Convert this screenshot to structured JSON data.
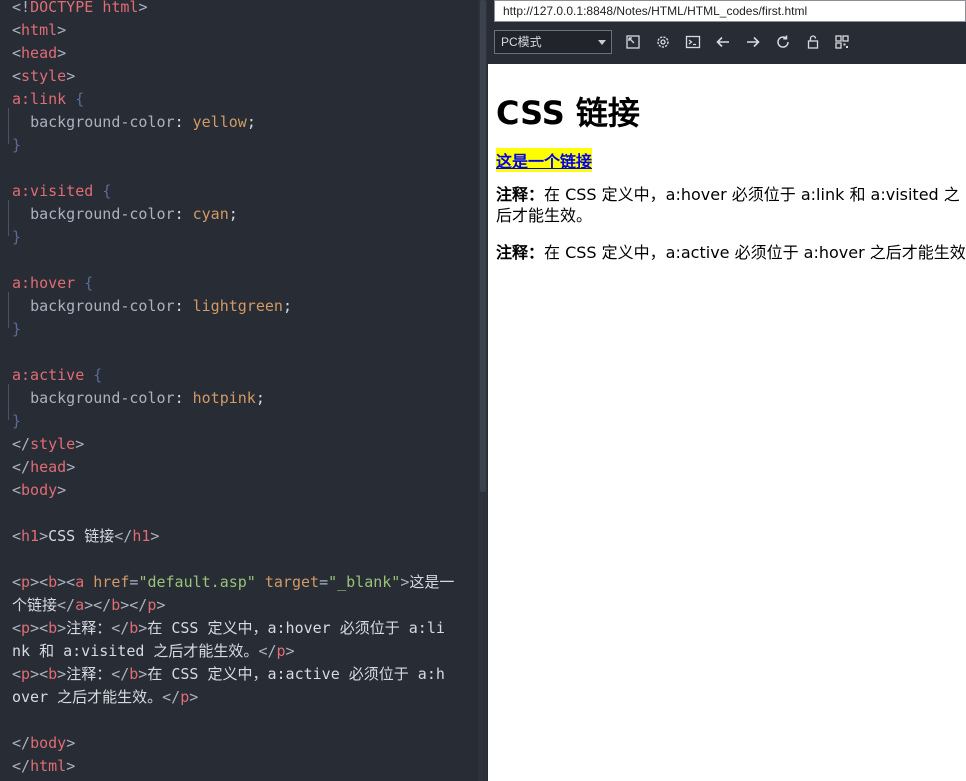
{
  "editor": {
    "lines": [
      [
        [
          "punc",
          "<!"
        ],
        [
          "doctype",
          "DOCTYPE "
        ],
        [
          "tag",
          "html"
        ],
        [
          "punc",
          ">"
        ]
      ],
      [
        [
          "punc",
          "<"
        ],
        [
          "tag",
          "html"
        ],
        [
          "punc",
          ">"
        ]
      ],
      [
        [
          "punc",
          "<"
        ],
        [
          "tag",
          "head"
        ],
        [
          "punc",
          ">"
        ]
      ],
      [
        [
          "punc",
          "<"
        ],
        [
          "tag",
          "style"
        ],
        [
          "punc",
          ">"
        ]
      ],
      [
        [
          "sel",
          "a:link"
        ],
        [
          "txt",
          " "
        ],
        [
          "brace",
          "{"
        ]
      ],
      [
        [
          "txt",
          "  "
        ],
        [
          "prop",
          "background-color"
        ],
        [
          "txt",
          ": "
        ],
        [
          "val",
          "yellow"
        ],
        [
          "txt",
          ";"
        ]
      ],
      [
        [
          "brace",
          "}"
        ]
      ],
      [
        [
          "txt",
          ""
        ]
      ],
      [
        [
          "sel",
          "a:visited"
        ],
        [
          "txt",
          " "
        ],
        [
          "brace",
          "{"
        ]
      ],
      [
        [
          "txt",
          "  "
        ],
        [
          "prop",
          "background-color"
        ],
        [
          "txt",
          ": "
        ],
        [
          "val",
          "cyan"
        ],
        [
          "txt",
          ";"
        ]
      ],
      [
        [
          "brace",
          "}"
        ]
      ],
      [
        [
          "txt",
          ""
        ]
      ],
      [
        [
          "sel",
          "a:hover"
        ],
        [
          "txt",
          " "
        ],
        [
          "brace",
          "{"
        ]
      ],
      [
        [
          "txt",
          "  "
        ],
        [
          "prop",
          "background-color"
        ],
        [
          "txt",
          ": "
        ],
        [
          "val",
          "lightgreen"
        ],
        [
          "txt",
          ";"
        ]
      ],
      [
        [
          "brace",
          "}"
        ]
      ],
      [
        [
          "txt",
          ""
        ]
      ],
      [
        [
          "sel",
          "a:active"
        ],
        [
          "txt",
          " "
        ],
        [
          "brace",
          "{"
        ]
      ],
      [
        [
          "txt",
          "  "
        ],
        [
          "prop",
          "background-color"
        ],
        [
          "txt",
          ": "
        ],
        [
          "val",
          "hotpink"
        ],
        [
          "txt",
          ";"
        ]
      ],
      [
        [
          "brace",
          "}"
        ]
      ],
      [
        [
          "punc",
          "</"
        ],
        [
          "tag",
          "style"
        ],
        [
          "punc",
          ">"
        ]
      ],
      [
        [
          "punc",
          "</"
        ],
        [
          "tag",
          "head"
        ],
        [
          "punc",
          ">"
        ]
      ],
      [
        [
          "punc",
          "<"
        ],
        [
          "tag",
          "body"
        ],
        [
          "punc",
          ">"
        ]
      ],
      [
        [
          "txt",
          ""
        ]
      ],
      [
        [
          "punc",
          "<"
        ],
        [
          "tag",
          "h1"
        ],
        [
          "punc",
          ">"
        ],
        [
          "txt",
          "CSS 链接"
        ],
        [
          "punc",
          "</"
        ],
        [
          "tag",
          "h1"
        ],
        [
          "punc",
          ">"
        ]
      ],
      [
        [
          "txt",
          ""
        ]
      ],
      [
        [
          "punc",
          "<"
        ],
        [
          "tag",
          "p"
        ],
        [
          "punc",
          "><"
        ],
        [
          "tag",
          "b"
        ],
        [
          "punc",
          "><"
        ],
        [
          "tag",
          "a"
        ],
        [
          "txt",
          " "
        ],
        [
          "attr",
          "href"
        ],
        [
          "punc",
          "="
        ],
        [
          "str",
          "\"default.asp\""
        ],
        [
          "txt",
          " "
        ],
        [
          "attr",
          "target"
        ],
        [
          "punc",
          "="
        ],
        [
          "str",
          "\"_blank\""
        ],
        [
          "punc",
          ">"
        ],
        [
          "txt",
          "这是一"
        ]
      ],
      [
        [
          "txt",
          "个链接"
        ],
        [
          "punc",
          "</"
        ],
        [
          "tag",
          "a"
        ],
        [
          "punc",
          "></"
        ],
        [
          "tag",
          "b"
        ],
        [
          "punc",
          "></"
        ],
        [
          "tag",
          "p"
        ],
        [
          "punc",
          ">"
        ]
      ],
      [
        [
          "punc",
          "<"
        ],
        [
          "tag",
          "p"
        ],
        [
          "punc",
          "><"
        ],
        [
          "tag",
          "b"
        ],
        [
          "punc",
          ">"
        ],
        [
          "txt",
          "注释："
        ],
        [
          "punc",
          "</"
        ],
        [
          "tag",
          "b"
        ],
        [
          "punc",
          ">"
        ],
        [
          "txt",
          "在 CSS 定义中，a:hover 必须位于 a:li"
        ]
      ],
      [
        [
          "txt",
          "nk 和 a:visited 之后才能生效。"
        ],
        [
          "punc",
          "</"
        ],
        [
          "tag",
          "p"
        ],
        [
          "punc",
          ">"
        ]
      ],
      [
        [
          "punc",
          "<"
        ],
        [
          "tag",
          "p"
        ],
        [
          "punc",
          "><"
        ],
        [
          "tag",
          "b"
        ],
        [
          "punc",
          ">"
        ],
        [
          "txt",
          "注释："
        ],
        [
          "punc",
          "</"
        ],
        [
          "tag",
          "b"
        ],
        [
          "punc",
          ">"
        ],
        [
          "txt",
          "在 CSS 定义中，a:active 必须位于 a:h"
        ]
      ],
      [
        [
          "txt",
          "over 之后才能生效。"
        ],
        [
          "punc",
          "</"
        ],
        [
          "tag",
          "p"
        ],
        [
          "punc",
          ">"
        ]
      ],
      [
        [
          "txt",
          ""
        ]
      ],
      [
        [
          "punc",
          "</"
        ],
        [
          "tag",
          "body"
        ],
        [
          "punc",
          ">"
        ]
      ],
      [
        [
          "punc",
          "</"
        ],
        [
          "tag",
          "html"
        ],
        [
          "punc",
          ">"
        ]
      ]
    ]
  },
  "browser": {
    "url": "http://127.0.0.1:8848/Notes/HTML/HTML_codes/first.html",
    "mode_select": "PC模式",
    "page": {
      "h1": "CSS 链接",
      "link_text": "这是一个链接",
      "note1_label": "注释：",
      "note1_text": "在 CSS 定义中，a:hover 必须位于 a:link 和 a:visited 之后才能生效。",
      "note2_label": "注释：",
      "note2_text": "在 CSS 定义中，a:active 必须位于 a:hover 之后才能生效。"
    }
  },
  "toolbar_icons": [
    "resize-icon",
    "settings-icon",
    "terminal-icon",
    "back-icon",
    "forward-icon",
    "refresh-icon",
    "lock-icon",
    "qrcode-icon"
  ],
  "colors": {
    "editor_bg": "#282c34",
    "tag": "#e06c75",
    "attr": "#d19a66",
    "string": "#98c379",
    "link_bg": "yellow",
    "link_color": "#0000ee"
  }
}
